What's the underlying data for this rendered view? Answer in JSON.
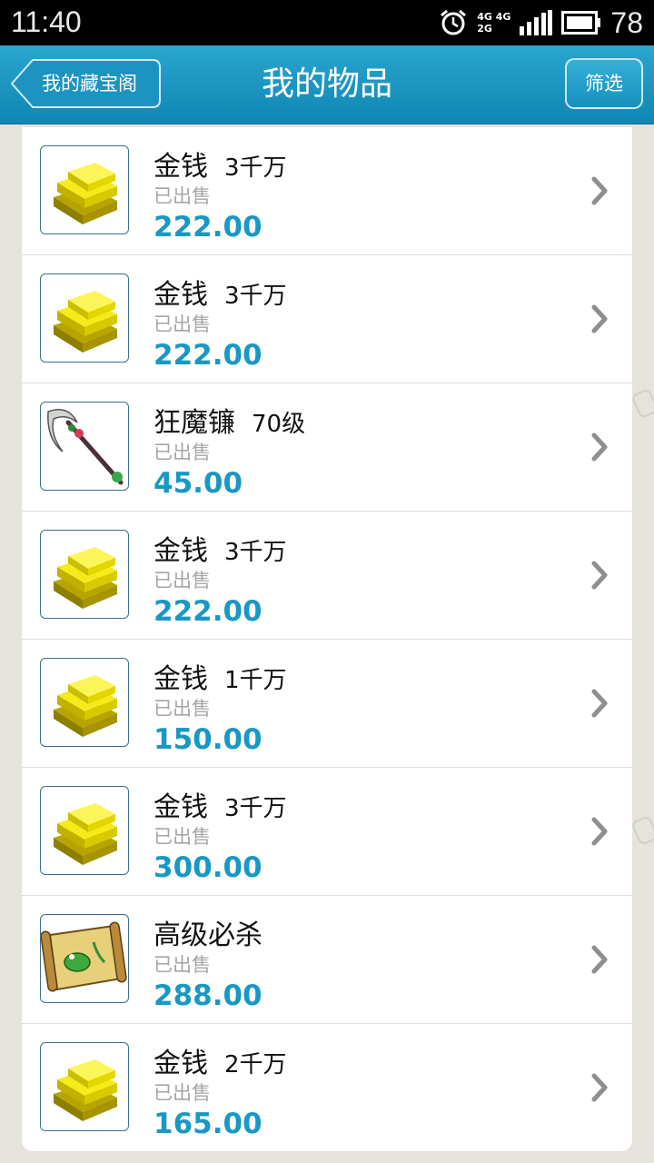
{
  "status_bar": {
    "time": "11:40",
    "battery": "78",
    "network_top": "4G 4G",
    "network_bottom": "2G"
  },
  "header": {
    "back_label": "我的藏宝阁",
    "title": "我的物品",
    "filter_label": "筛选"
  },
  "items": [
    {
      "name": "金钱",
      "qty": "3千万",
      "status": "已出售",
      "price": "222.00",
      "icon": "gold-bars-icon"
    },
    {
      "name": "金钱",
      "qty": "3千万",
      "status": "已出售",
      "price": "222.00",
      "icon": "gold-bars-icon"
    },
    {
      "name": "狂魔镰",
      "qty": "70级",
      "status": "已出售",
      "price": "45.00",
      "icon": "scythe-weapon-icon"
    },
    {
      "name": "金钱",
      "qty": "3千万",
      "status": "已出售",
      "price": "222.00",
      "icon": "gold-bars-icon"
    },
    {
      "name": "金钱",
      "qty": "1千万",
      "status": "已出售",
      "price": "150.00",
      "icon": "gold-bars-icon"
    },
    {
      "name": "金钱",
      "qty": "3千万",
      "status": "已出售",
      "price": "300.00",
      "icon": "gold-bars-icon"
    },
    {
      "name": "高级必杀",
      "qty": "",
      "status": "已出售",
      "price": "288.00",
      "icon": "skill-scroll-icon"
    },
    {
      "name": "金钱",
      "qty": "2千万",
      "status": "已出售",
      "price": "165.00",
      "icon": "gold-bars-icon"
    }
  ],
  "colors": {
    "header": "#1b96c3",
    "price": "#1898c4",
    "status_text": "#a6a6a6"
  }
}
